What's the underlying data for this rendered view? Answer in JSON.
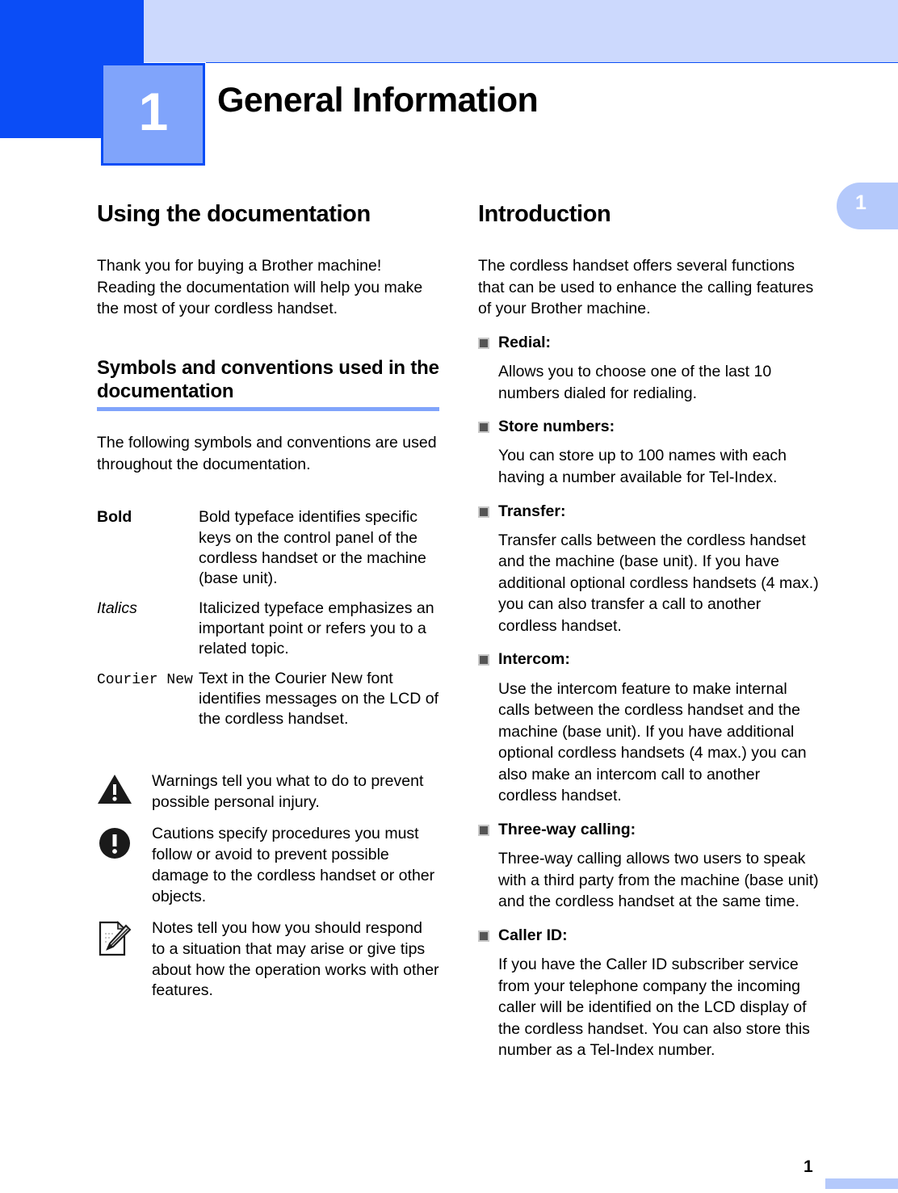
{
  "chapter": {
    "number": "1",
    "title": "General Information",
    "side_tab_number": "1"
  },
  "colors": {
    "primary_blue": "#0b4df6",
    "band_blue": "#ccd9fd",
    "box_blue": "#80a4fb",
    "tab_blue": "#b4c9fb",
    "bullet_gray": "#555555"
  },
  "left_column": {
    "heading": "Using the documentation",
    "intro": "Thank you for buying a Brother machine! Reading the documentation will help you make the most of your cordless handset.",
    "subheading": "Symbols and conventions used in the documentation",
    "subintro": "The following symbols and conventions are used throughout the documentation.",
    "conventions": [
      {
        "term": "Bold",
        "term_style": "bold",
        "description": "Bold typeface identifies specific keys on the control panel of the cordless handset or the machine (base unit)."
      },
      {
        "term": "Italics",
        "term_style": "italic",
        "description": "Italicized typeface emphasizes an important point or refers you to a related topic."
      },
      {
        "term": "Courier New",
        "term_style": "mono",
        "description": "Text in the Courier New font identifies messages on the LCD of the cordless handset."
      }
    ],
    "symbols": [
      {
        "icon": "warning-triangle-icon",
        "text": "Warnings tell you what to do to prevent possible personal injury."
      },
      {
        "icon": "caution-circle-icon",
        "text": "Cautions specify procedures you must follow or avoid to prevent possible damage to the cordless handset or other objects."
      },
      {
        "icon": "note-pencil-icon",
        "text": "Notes tell you how you should respond to a situation that may arise or give tips about how the operation works with other features."
      }
    ]
  },
  "right_column": {
    "heading": "Introduction",
    "intro": "The cordless handset offers several functions that can be used to enhance the calling features of your Brother machine.",
    "features": [
      {
        "label": "Redial:",
        "body": "Allows you to choose one of the last 10 numbers dialed for redialing."
      },
      {
        "label": "Store numbers:",
        "body": "You can store up to 100 names with each having a number available for Tel-Index."
      },
      {
        "label": "Transfer:",
        "body": "Transfer calls between the cordless handset and the machine (base unit). If you have additional optional cordless handsets (4 max.) you can also transfer a call to another cordless handset."
      },
      {
        "label": "Intercom:",
        "body": "Use the intercom feature to make internal calls between the cordless handset and the machine (base unit). If you have additional optional cordless handsets (4 max.) you can also make an intercom call to another cordless handset."
      },
      {
        "label": "Three-way calling:",
        "body": "Three-way calling allows two users to speak with a third party from the machine (base unit) and the cordless handset at the same time."
      },
      {
        "label": "Caller ID:",
        "body": "If you have the Caller ID subscriber service from your telephone company the incoming caller will be identified on the LCD display of the cordless handset. You can also store this number as a Tel-Index number."
      }
    ]
  },
  "footer": {
    "page_number": "1"
  }
}
